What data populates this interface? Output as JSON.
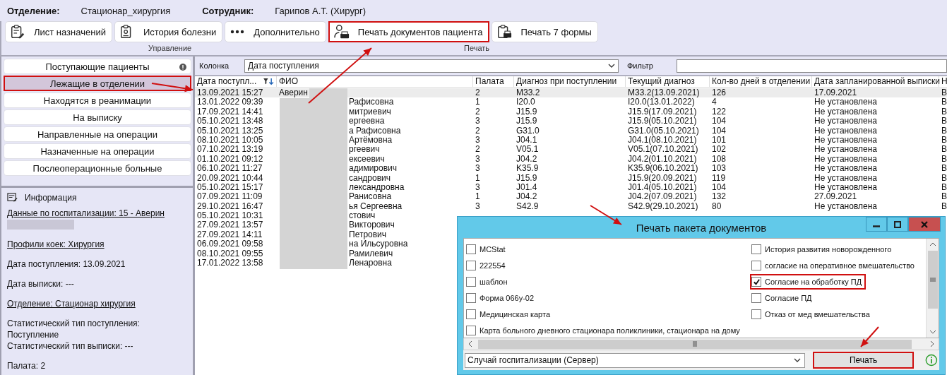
{
  "header": {
    "department_label": "Отделение:",
    "department": "Стационар_хирургия",
    "employee_label": "Сотрудник:",
    "employee": "Гарипов А.Т. (Хирург)"
  },
  "toolbar": {
    "buttons": [
      {
        "label": "Лист назначений",
        "highlighted": false
      },
      {
        "label": "История болезни",
        "highlighted": false
      },
      {
        "label": "Дополнительно",
        "highlighted": false
      },
      {
        "label": "Печать документов пациента",
        "highlighted": true
      },
      {
        "label": "Печать 7 формы",
        "highlighted": false
      }
    ],
    "groups": [
      {
        "label": "Управление"
      },
      {
        "label": "Печать"
      }
    ]
  },
  "sidebar": {
    "items": [
      {
        "label": "Поступающие пациенты",
        "selected": false,
        "highlighted": false,
        "alert": true
      },
      {
        "label": "Лежащие в отделении",
        "selected": true,
        "highlighted": true,
        "alert": false
      },
      {
        "label": "Находятся в реанимации",
        "selected": false,
        "highlighted": false,
        "alert": false
      },
      {
        "label": "На выписку",
        "selected": false,
        "highlighted": false,
        "alert": false
      },
      {
        "label": "Направленные на операции",
        "selected": false,
        "highlighted": false,
        "alert": false
      },
      {
        "label": "Назначенные на операции",
        "selected": false,
        "highlighted": false,
        "alert": false
      },
      {
        "label": "Послеоперационные больные",
        "selected": false,
        "highlighted": false,
        "alert": false
      }
    ]
  },
  "info": {
    "title": "Информация",
    "blocks": [
      [
        {
          "kind": "link",
          "text": "Данные по госпитализации: 15 - Аверин"
        },
        {
          "kind": "redacted"
        }
      ],
      [
        {
          "kind": "link",
          "text": "Профили коек: Хирургия"
        }
      ],
      [
        {
          "kind": "text",
          "text": "Дата поступления: 13.09.2021"
        }
      ],
      [
        {
          "kind": "text",
          "text": "Дата выписки: ---"
        }
      ],
      [
        {
          "kind": "link",
          "text": "Отделение: Стационар хирургия"
        }
      ],
      [
        {
          "kind": "text",
          "text": "Статистический тип поступления:"
        },
        {
          "kind": "text",
          "text": "Поступление"
        },
        {
          "kind": "text",
          "text": "Статистический тип выписки: ---"
        }
      ],
      [
        {
          "kind": "text",
          "text": "Палата: 2"
        }
      ]
    ]
  },
  "filter": {
    "column_label": "Колонка",
    "column_value": "Дата поступления",
    "filter_label": "Фильтр"
  },
  "table": {
    "columns": [
      {
        "label": "Дата поступл...",
        "sorted": true
      },
      {
        "label": "ФИО"
      },
      {
        "label": "Палата"
      },
      {
        "label": "Диагноз при поступлении"
      },
      {
        "label": "Текущий диагноз"
      },
      {
        "label": "Кол-во дней в отделении"
      },
      {
        "label": "Дата запланированной выписки"
      },
      {
        "label": "Н"
      }
    ],
    "rows": [
      {
        "selected": true,
        "cells": [
          "13.09.2021 15:27",
          "Аверин",
          "2",
          "M33.2",
          "M33.2(13.09.2021)",
          "126",
          "17.09.2021",
          "В"
        ]
      },
      {
        "selected": false,
        "cells": [
          "13.01.2022 09:39",
          "Рафисовна",
          "1",
          "I20.0",
          "I20.0(13.01.2022)",
          "4",
          "Не установлена",
          "В"
        ]
      },
      {
        "selected": false,
        "cells": [
          "17.09.2021 14:41",
          "митриевич",
          "2",
          "J15.9",
          "J15.9(17.09.2021)",
          "122",
          "Не установлена",
          "В"
        ]
      },
      {
        "selected": false,
        "cells": [
          "05.10.2021 13:48",
          "ергеевна",
          "3",
          "J15.9",
          "J15.9(05.10.2021)",
          "104",
          "Не установлена",
          "В"
        ]
      },
      {
        "selected": false,
        "cells": [
          "05.10.2021 13:25",
          "а Рафисовна",
          "2",
          "G31.0",
          "G31.0(05.10.2021)",
          "104",
          "Не установлена",
          "В"
        ]
      },
      {
        "selected": false,
        "cells": [
          "08.10.2021 10:05",
          "Артёмовна",
          "3",
          "J04.1",
          "J04.1(08.10.2021)",
          "101",
          "Не установлена",
          "В"
        ]
      },
      {
        "selected": false,
        "cells": [
          "07.10.2021 13:19",
          "ргеевич",
          "2",
          "V05.1",
          "V05.1(07.10.2021)",
          "102",
          "Не установлена",
          "В"
        ]
      },
      {
        "selected": false,
        "cells": [
          "01.10.2021 09:12",
          "ексеевич",
          "3",
          "J04.2",
          "J04.2(01.10.2021)",
          "108",
          "Не установлена",
          "В"
        ]
      },
      {
        "selected": false,
        "cells": [
          "06.10.2021 11:27",
          "адимирович",
          "3",
          "K35.9",
          "K35.9(06.10.2021)",
          "103",
          "Не установлена",
          "В"
        ]
      },
      {
        "selected": false,
        "cells": [
          "20.09.2021 10:44",
          "сандрович",
          "1",
          "J15.9",
          "J15.9(20.09.2021)",
          "119",
          "Не установлена",
          "В"
        ]
      },
      {
        "selected": false,
        "cells": [
          "05.10.2021 15:17",
          "лександровна",
          "3",
          "J01.4",
          "J01.4(05.10.2021)",
          "104",
          "Не установлена",
          "В"
        ]
      },
      {
        "selected": false,
        "cells": [
          "07.09.2021 11:09",
          "Ранисовна",
          "1",
          "J04.2",
          "J04.2(07.09.2021)",
          "132",
          "27.09.2021",
          "В"
        ]
      },
      {
        "selected": false,
        "cells": [
          "29.10.2021 16:47",
          "ья Сергеевна",
          "3",
          "S42.9",
          "S42.9(29.10.2021)",
          "80",
          "Не установлена",
          "В"
        ]
      },
      {
        "selected": false,
        "cells": [
          "05.10.2021 10:31",
          "стович"
        ]
      },
      {
        "selected": false,
        "cells": [
          "27.09.2021 13:57",
          "Викторович"
        ]
      },
      {
        "selected": false,
        "cells": [
          "27.09.2021 14:11",
          "Петрович"
        ]
      },
      {
        "selected": false,
        "cells": [
          "06.09.2021 09:58",
          "на Ильсуровна"
        ]
      },
      {
        "selected": false,
        "cells": [
          "08.10.2021 09:55",
          "Рамилевич"
        ]
      },
      {
        "selected": false,
        "cells": [
          "17.01.2022 13:58",
          "Ленаровна"
        ]
      }
    ]
  },
  "dialog": {
    "title": "Печать пакета документов",
    "left_items": [
      {
        "label": "MCStat",
        "checked": false,
        "highlighted": false
      },
      {
        "label": "222554",
        "checked": false,
        "highlighted": false
      },
      {
        "label": "шаблон",
        "checked": false,
        "highlighted": false
      },
      {
        "label": "Форма 066у-02",
        "checked": false,
        "highlighted": false
      },
      {
        "label": "Медицинская карта",
        "checked": false,
        "highlighted": false
      },
      {
        "label": "Карта больного дневного стационара поликлиники, стационара на дому",
        "checked": false,
        "highlighted": false
      }
    ],
    "right_items": [
      {
        "label": "История развития новорожденного",
        "checked": false,
        "highlighted": false
      },
      {
        "label": "согласие на оперативное вмешательство",
        "checked": false,
        "highlighted": false
      },
      {
        "label": "Согласие на обработку ПД",
        "checked": true,
        "highlighted": true
      },
      {
        "label": "Согласие ПД",
        "checked": false,
        "highlighted": false
      },
      {
        "label": "Отказ от мед вмешательства",
        "checked": false,
        "highlighted": false
      }
    ],
    "source": {
      "value": "Случай госпитализации (Сервер)"
    },
    "print_button": {
      "label": "Печать",
      "highlighted": true
    }
  }
}
